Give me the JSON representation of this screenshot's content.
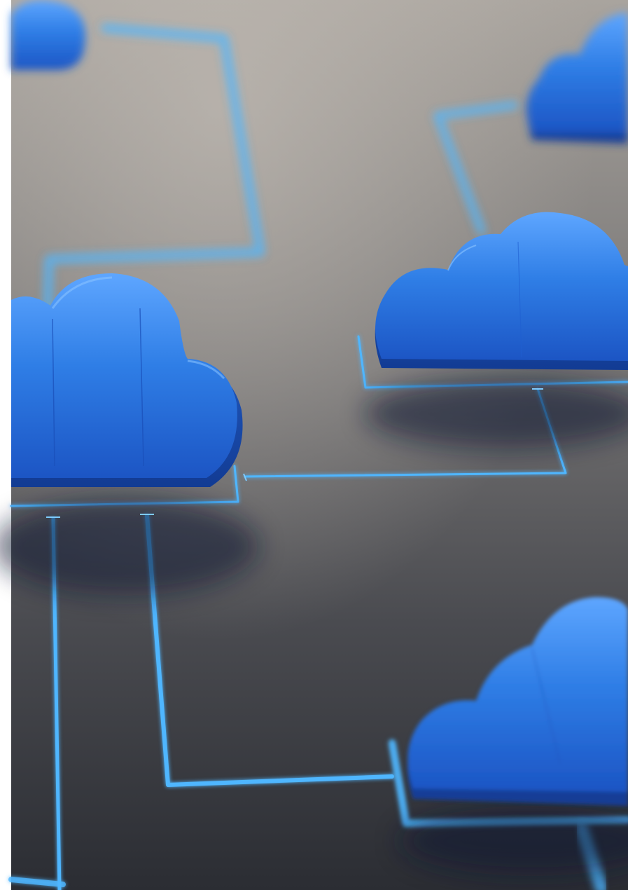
{
  "image": {
    "subject": "cloud-network",
    "cloud_count": 5,
    "colors": {
      "cloud_blue": "#2f7ee6",
      "cloud_dark": "#1a4fb8",
      "circuit_glow": "#4fb6ff",
      "surface_top": "#a8a39e",
      "surface_bottom": "#2b2d33"
    }
  }
}
